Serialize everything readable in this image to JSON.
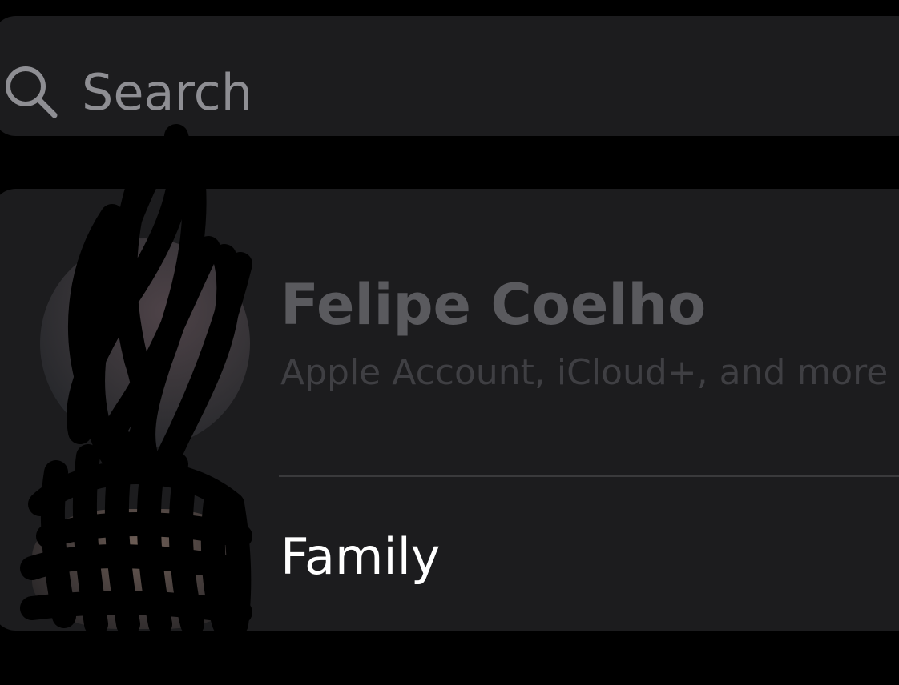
{
  "search": {
    "placeholder": "Search",
    "icon": "magnifying-glass"
  },
  "account": {
    "name": "Felipe Coelho",
    "subtitle": "Apple Account, iCloud+, and more"
  },
  "family": {
    "label": "Family"
  },
  "colors": {
    "background": "#000000",
    "surface": "#1c1c1e",
    "placeholder_text": "#8e8e93",
    "dimmed_name": "#5a5a5e",
    "dimmed_subtitle": "#3f3f43",
    "primary_text": "#ffffff",
    "separator": "#3a3a3c"
  }
}
